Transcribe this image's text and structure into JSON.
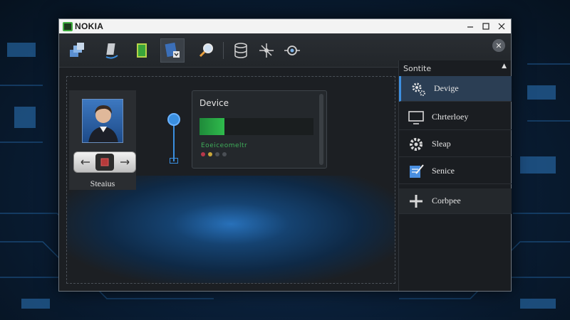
{
  "window": {
    "title": "NOKIA"
  },
  "toolbar": {
    "tools": [
      {
        "icon": "server-stack-icon"
      },
      {
        "icon": "monitor-arrow-icon"
      },
      {
        "icon": "green-cube-icon"
      },
      {
        "icon": "document-download-icon",
        "active": true
      },
      {
        "icon": "magnifier-icon"
      },
      {
        "icon": "database-icon"
      },
      {
        "icon": "network-nodes-icon"
      },
      {
        "icon": "eye-orbit-icon"
      }
    ]
  },
  "profile": {
    "label": "Steaius"
  },
  "device": {
    "title": "Device",
    "subtitle": "Eoeiceomeltr",
    "level": 0.22
  },
  "sidebar": {
    "header": "Sontite",
    "items": [
      {
        "label": "Devige",
        "icon": "gear-cluster-icon",
        "selected": true
      },
      {
        "label": "Chrterloey",
        "icon": "monitor-icon"
      },
      {
        "label": "Sleap",
        "icon": "gear-icon"
      },
      {
        "label": "Senice",
        "icon": "notepad-edit-icon"
      },
      {
        "label": "Corbpee",
        "icon": "plus-icon"
      }
    ]
  },
  "colors": {
    "accent": "#3d8fe0",
    "green": "#2fbb4c",
    "titlebar": "#f3f3f3"
  }
}
